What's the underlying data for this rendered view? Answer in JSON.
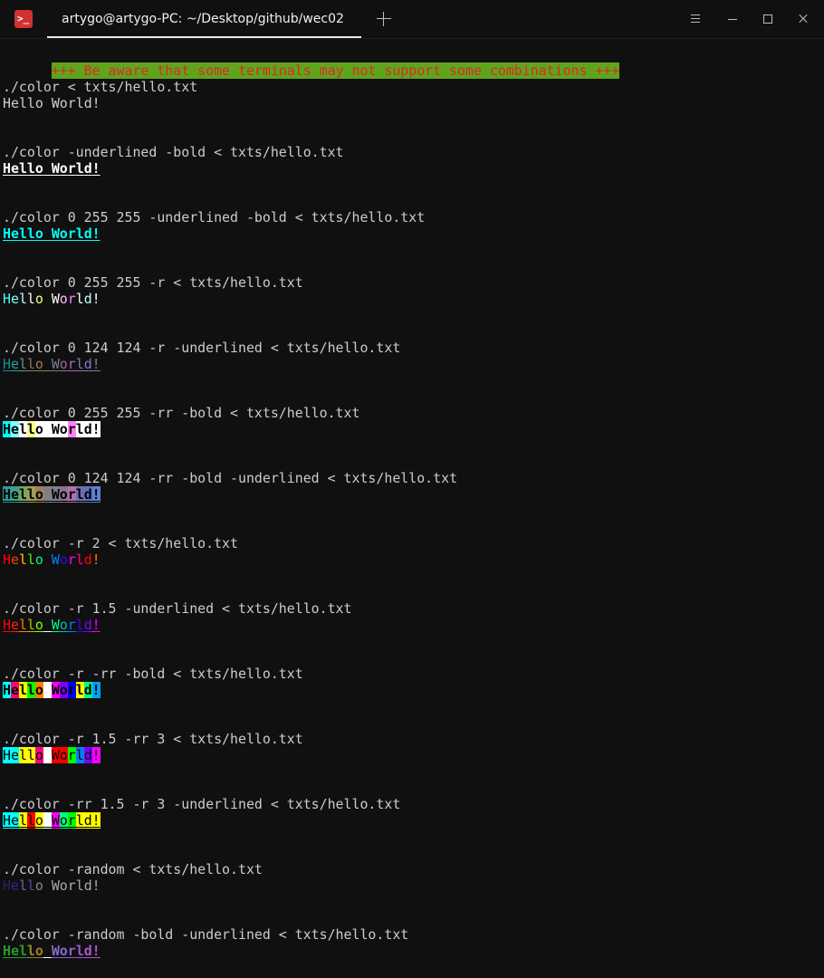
{
  "window": {
    "tab_title": "artygo@artygo-PC: ~/Desktop/github/wec02",
    "app_icon_glyph": ">_"
  },
  "terminal": {
    "warning": "+++ Be aware that some terminals may not support some combinations +++",
    "blocks": [
      {
        "command": "./color < txts/hello.txt",
        "output": "Hello World!"
      },
      {
        "command": "./color -underlined -bold < txts/hello.txt",
        "output": "Hello World!"
      },
      {
        "command": "./color 0 255 255 -underlined -bold < txts/hello.txt",
        "output": "Hello World!"
      },
      {
        "command": "./color 0 255 255 -r < txts/hello.txt",
        "output": "Hello World!"
      },
      {
        "command": "./color 0 124 124 -r -underlined < txts/hello.txt",
        "output": "Hello World!"
      },
      {
        "command": "./color 0 255 255 -rr -bold < txts/hello.txt",
        "output": "Hello World!"
      },
      {
        "command": "./color 0 124 124 -rr -bold -underlined < txts/hello.txt",
        "output": "Hello World!"
      },
      {
        "command": "./color -r 2 < txts/hello.txt",
        "output": "Hello World!"
      },
      {
        "command": "./color -r 1.5 -underlined < txts/hello.txt",
        "output": "Hello World!"
      },
      {
        "command": "./color -r -rr -bold < txts/hello.txt",
        "output": "Hello World!"
      },
      {
        "command": "./color -r 1.5 -rr 3 < txts/hello.txt",
        "output": "Hello World!"
      },
      {
        "command": "./color -rr 1.5 -r 3 -underlined < txts/hello.txt",
        "output": "Hello World!"
      },
      {
        "command": "./color -random < txts/hello.txt",
        "output": "Hello World!"
      },
      {
        "command": "./color -random -bold -underlined < txts/hello.txt",
        "output": "Hello World!"
      }
    ]
  },
  "colors": {
    "background": "#101010",
    "text": "#cccccc",
    "warning_bg": "#5ea51b",
    "warning_fg": "#e02828",
    "cyan": "#00ffff"
  },
  "styles": [
    {
      "fg": [
        "#d0d0d0"
      ],
      "bg": null,
      "bold": false,
      "underline": false
    },
    {
      "fg": [
        "#ffffff"
      ],
      "bg": null,
      "bold": true,
      "underline": true
    },
    {
      "fg": [
        "#00ffff"
      ],
      "bg": null,
      "bold": true,
      "underline": true
    },
    {
      "fg": [
        "#40ffff",
        "#80ffff",
        "#c0ffff",
        "#ffffff",
        "#ffff80",
        "#ffffff",
        "#ffffff",
        "#ffc0ff",
        "#ff80ff",
        "#ffffff",
        "#c0ffff",
        "#ffffff"
      ],
      "bg": null,
      "bold": false,
      "underline": false
    },
    {
      "fg": [
        "#1a8c8c",
        "#2aa0a0",
        "#5aa080",
        "#8c7c50",
        "#a07c60",
        "#808080",
        "#7c7c9c",
        "#9c6c9c",
        "#b06cb0",
        "#7c7cb8",
        "#7c7cc8",
        "#7c7cb8"
      ],
      "bg": null,
      "bold": false,
      "underline": true
    },
    {
      "fg": [
        "#000000"
      ],
      "bg": [
        "#00ffff",
        "#80ffff",
        "#ffffff",
        "#ffff80",
        "#ffffff",
        "#ffffff",
        "#ffffff",
        "#ffffff",
        "#ff80ff",
        "#ffffff",
        "#ffffff",
        "#ffffff"
      ],
      "bold": true,
      "underline": false
    },
    {
      "fg": [
        "#000000"
      ],
      "bg": [
        "#2a9c9c",
        "#40a080",
        "#70a860",
        "#a0a050",
        "#a08060",
        "#808080",
        "#808090",
        "#907090",
        "#b070b0",
        "#7070b0",
        "#6070c0",
        "#6080d0"
      ],
      "bold": true,
      "underline": true
    },
    {
      "fg": [
        "#ff0000",
        "#ff4000",
        "#ffc000",
        "#40ff00",
        "#00ff80",
        "#ffffff",
        "#0080ff",
        "#4000ff",
        "#ff00ff",
        "#ff0080",
        "#ff0000",
        "#ff8000"
      ],
      "bg": null,
      "bold": false,
      "underline": false
    },
    {
      "fg": [
        "#ff0000",
        "#ff2000",
        "#ff8000",
        "#c0c000",
        "#80ff00",
        "#ffffff",
        "#00ff80",
        "#00c0c0",
        "#0080ff",
        "#4000ff",
        "#8000ff",
        "#ff00ff"
      ],
      "bg": null,
      "bold": false,
      "underline": true
    },
    {
      "fg": [
        "#000000",
        "#000000",
        "#000000",
        "#000000",
        "#000000",
        "#000000",
        "#000000",
        "#000000",
        "#000000",
        "#000000",
        "#000000",
        "#000000"
      ],
      "bg": [
        "#00ffff",
        "#ff0080",
        "#ffff00",
        "#00ff00",
        "#ff8000",
        "#ffffff",
        "#ff00ff",
        "#8000ff",
        "#0000ff",
        "#ffff00",
        "#00ff80",
        "#00a0ff"
      ],
      "bold": true,
      "underline": false
    },
    {
      "fg": [
        "#000000"
      ],
      "bg": [
        "#00ffff",
        "#00ffff",
        "#ffff00",
        "#ffff00",
        "#ff0080",
        "#ffffff",
        "#ff0000",
        "#ff0000",
        "#00ff00",
        "#0080ff",
        "#8000ff",
        "#ff00ff"
      ],
      "bold": false,
      "underline": false
    },
    {
      "fg": [
        "#000000"
      ],
      "bg": [
        "#00ffff",
        "#00ffff",
        "#ffff00",
        "#ff0000",
        "#ffff00",
        "#ffffff",
        "#ff00ff",
        "#00ff80",
        "#00ff00",
        "#ffff00",
        "#ffff00",
        "#ffff00"
      ],
      "bold": false,
      "underline": true
    },
    {
      "fg": [
        "#3a1a6a",
        "#2a2a8a",
        "#6a6aaa",
        "#4a4aaa",
        "#8a8a8a",
        "#ffffff",
        "#aaaaaa",
        "#aaaaaa",
        "#aaaaaa",
        "#aaaaaa",
        "#aaaaaa",
        "#aaaaaa"
      ],
      "bg": null,
      "bold": false,
      "underline": false
    },
    {
      "fg": [
        "#2a9a2a",
        "#2a9a2a",
        "#2a9a2a",
        "#8a8a2a",
        "#aa7a2a",
        "#ffffff",
        "#8a6acc",
        "#8a6acc",
        "#9a5acc",
        "#9a5acc",
        "#aa5acc",
        "#aa5acc"
      ],
      "bg": null,
      "bold": true,
      "underline": true
    }
  ]
}
